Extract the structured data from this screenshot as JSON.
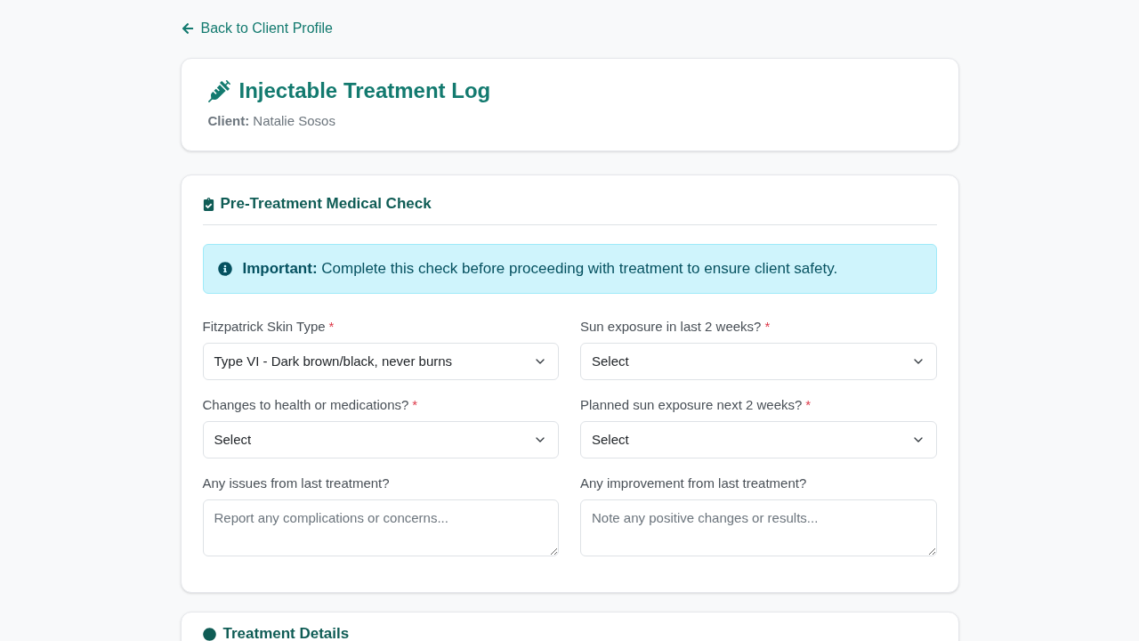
{
  "back_link": {
    "label": "Back to Client Profile"
  },
  "header": {
    "title": "Injectable Treatment Log",
    "client": "**Client:** Natalie Sosos"
  },
  "medical_check": {
    "title": "Pre-Treatment Medical Check",
    "alert": "**Important:** Complete this check before proceeding with treatment to ensure client safety.",
    "fields": [
      {
        "kind": "select",
        "label": "Fitzpatrick Skin Type",
        "required_mark": "*",
        "value": "Type VI - Dark brown/black, never burns"
      },
      {
        "kind": "select",
        "label": "Sun exposure in last 2 weeks?",
        "required_mark": "*",
        "value": "Select"
      },
      {
        "kind": "select",
        "label": "Changes to health or medications?",
        "required_mark": "*",
        "value": "Select"
      },
      {
        "kind": "select",
        "label": "Planned sun exposure next 2 weeks?",
        "required_mark": "*",
        "value": "Select"
      },
      {
        "kind": "textarea",
        "label": "Any issues from last treatment?",
        "placeholder": "Report any complications or concerns..."
      },
      {
        "kind": "textarea",
        "label": "Any improvement from last treatment?",
        "placeholder": "Note any positive changes or results..."
      }
    ]
  },
  "treatment_details": {
    "title": "Treatment Details"
  }
}
